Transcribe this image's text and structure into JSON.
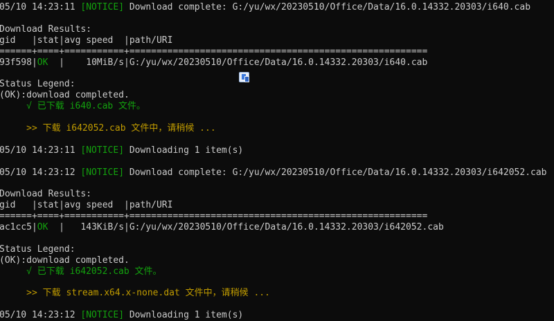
{
  "terminal": {
    "lines": [
      {
        "segments": [
          {
            "t": "05/10 14:23:11 ",
            "c": "dim"
          },
          {
            "t": "[NOTICE]",
            "c": "notice"
          },
          {
            "t": " Download complete: G:/yu/wx/20230510/Office/Data/16.0.14332.20303/i640.cab",
            "c": "dim"
          }
        ]
      },
      {
        "segments": [
          {
            "t": "",
            "c": "dim"
          }
        ]
      },
      {
        "segments": [
          {
            "t": "Download Results:",
            "c": "dim"
          }
        ]
      },
      {
        "segments": [
          {
            "t": "gid   |stat|avg speed  |path/URI",
            "c": "dim"
          }
        ]
      },
      {
        "segments": [
          {
            "t": "======+====+===========+=======================================================",
            "c": "dim"
          }
        ]
      },
      {
        "segments": [
          {
            "t": "93f598|",
            "c": "dim"
          },
          {
            "t": "OK",
            "c": "ok"
          },
          {
            "t": "  |    10MiB/s|G:/yu/wx/20230510/Office/Data/16.0.14332.20303/i640.cab",
            "c": "dim"
          }
        ]
      },
      {
        "segments": [
          {
            "t": "",
            "c": "dim"
          }
        ]
      },
      {
        "segments": [
          {
            "t": "Status Legend:",
            "c": "dim"
          }
        ]
      },
      {
        "segments": [
          {
            "t": "(OK):download completed.",
            "c": "dim"
          }
        ]
      },
      {
        "segments": [
          {
            "t": "     √ 已下载 i640.cab 文件。",
            "c": "ok"
          }
        ]
      },
      {
        "segments": [
          {
            "t": "",
            "c": "dim"
          }
        ]
      },
      {
        "segments": [
          {
            "t": "     >> 下载 i642052.cab 文件中，请稍候 ...",
            "c": "yellow"
          }
        ]
      },
      {
        "segments": [
          {
            "t": "",
            "c": "dim"
          }
        ]
      },
      {
        "segments": [
          {
            "t": "05/10 14:23:11 ",
            "c": "dim"
          },
          {
            "t": "[NOTICE]",
            "c": "notice"
          },
          {
            "t": " Downloading 1 item(s)",
            "c": "dim"
          }
        ]
      },
      {
        "segments": [
          {
            "t": "",
            "c": "dim"
          }
        ]
      },
      {
        "segments": [
          {
            "t": "05/10 14:23:12 ",
            "c": "dim"
          },
          {
            "t": "[NOTICE]",
            "c": "notice"
          },
          {
            "t": " Download complete: G:/yu/wx/20230510/Office/Data/16.0.14332.20303/i642052.cab",
            "c": "dim"
          }
        ]
      },
      {
        "segments": [
          {
            "t": "",
            "c": "dim"
          }
        ]
      },
      {
        "segments": [
          {
            "t": "Download Results:",
            "c": "dim"
          }
        ]
      },
      {
        "segments": [
          {
            "t": "gid   |stat|avg speed  |path/URI",
            "c": "dim"
          }
        ]
      },
      {
        "segments": [
          {
            "t": "======+====+===========+=======================================================",
            "c": "dim"
          }
        ]
      },
      {
        "segments": [
          {
            "t": "ac1cc5|",
            "c": "dim"
          },
          {
            "t": "OK",
            "c": "ok"
          },
          {
            "t": "  |   143KiB/s|G:/yu/wx/20230510/Office/Data/16.0.14332.20303/i642052.cab",
            "c": "dim"
          }
        ]
      },
      {
        "segments": [
          {
            "t": "",
            "c": "dim"
          }
        ]
      },
      {
        "segments": [
          {
            "t": "Status Legend:",
            "c": "dim"
          }
        ]
      },
      {
        "segments": [
          {
            "t": "(OK):download completed.",
            "c": "dim"
          }
        ]
      },
      {
        "segments": [
          {
            "t": "     √ 已下载 i642052.cab 文件。",
            "c": "ok"
          }
        ]
      },
      {
        "segments": [
          {
            "t": "",
            "c": "dim"
          }
        ]
      },
      {
        "segments": [
          {
            "t": "     >> 下载 stream.x64.x-none.dat 文件中，请稍候 ...",
            "c": "yellow"
          }
        ]
      },
      {
        "segments": [
          {
            "t": "",
            "c": "dim"
          }
        ]
      },
      {
        "segments": [
          {
            "t": "05/10 14:23:12 ",
            "c": "dim"
          },
          {
            "t": "[NOTICE]",
            "c": "notice"
          },
          {
            "t": " Downloading 1 item(s)",
            "c": "dim"
          }
        ]
      }
    ]
  },
  "floating_icon": "translate-icon"
}
